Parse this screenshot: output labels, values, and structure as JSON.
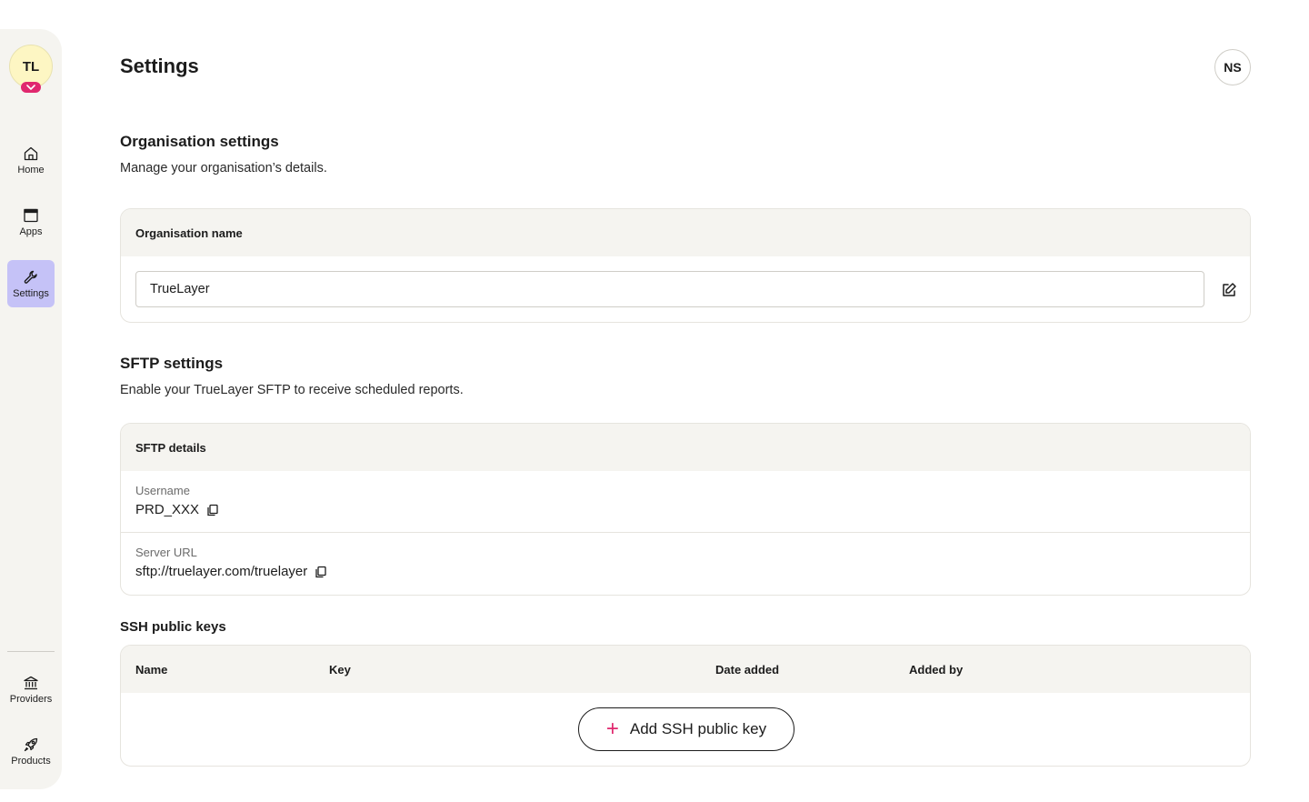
{
  "sidebar": {
    "org_initials": "TL",
    "nav": [
      {
        "label": "Home",
        "icon": "home-icon"
      },
      {
        "label": "Apps",
        "icon": "apps-icon"
      },
      {
        "label": "Settings",
        "icon": "wrench-icon",
        "active": true
      }
    ],
    "bottom_nav": [
      {
        "label": "Providers",
        "icon": "bank-icon"
      },
      {
        "label": "Products",
        "icon": "rocket-icon"
      }
    ]
  },
  "header": {
    "title": "Settings",
    "user_initials": "NS"
  },
  "organisation": {
    "title": "Organisation settings",
    "description": "Manage your organisation’s details.",
    "card_header": "Organisation name",
    "name_value": "TrueLayer"
  },
  "sftp": {
    "title": "SFTP settings",
    "description": "Enable your TrueLayer SFTP to receive scheduled reports.",
    "card_header": "SFTP details",
    "username_label": "Username",
    "username_value": "PRD_XXX",
    "server_label": "Server URL",
    "server_value": "sftp://truelayer.com/truelayer"
  },
  "ssh": {
    "title": "SSH public keys",
    "columns": [
      "Name",
      "Key",
      "Date added",
      "Added by"
    ],
    "add_label": "Add SSH public key"
  },
  "colors": {
    "accent": "#e0286e",
    "active_nav": "#c5c2f7",
    "sidebar_bg": "#f5f4f0",
    "org_avatar_bg": "#fdf6c3"
  }
}
